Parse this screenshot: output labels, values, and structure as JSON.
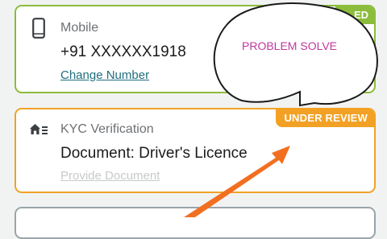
{
  "mobile": {
    "label": "Mobile",
    "number": "+91 XXXXXX1918",
    "change_label": "Change Number",
    "badge": "ED",
    "icon": "smartphone-icon",
    "accent": "#8cbc3b"
  },
  "kyc": {
    "label": "KYC Verification",
    "document": "Document: Driver's Licence",
    "provide_label": "Provide Document",
    "badge": "UNDER REVIEW",
    "icon": "home-list-icon",
    "accent": "#f2a125"
  },
  "annotation": {
    "bubble_text": "PROBLEM SOLVE",
    "arrow_color": "#f26f21"
  }
}
